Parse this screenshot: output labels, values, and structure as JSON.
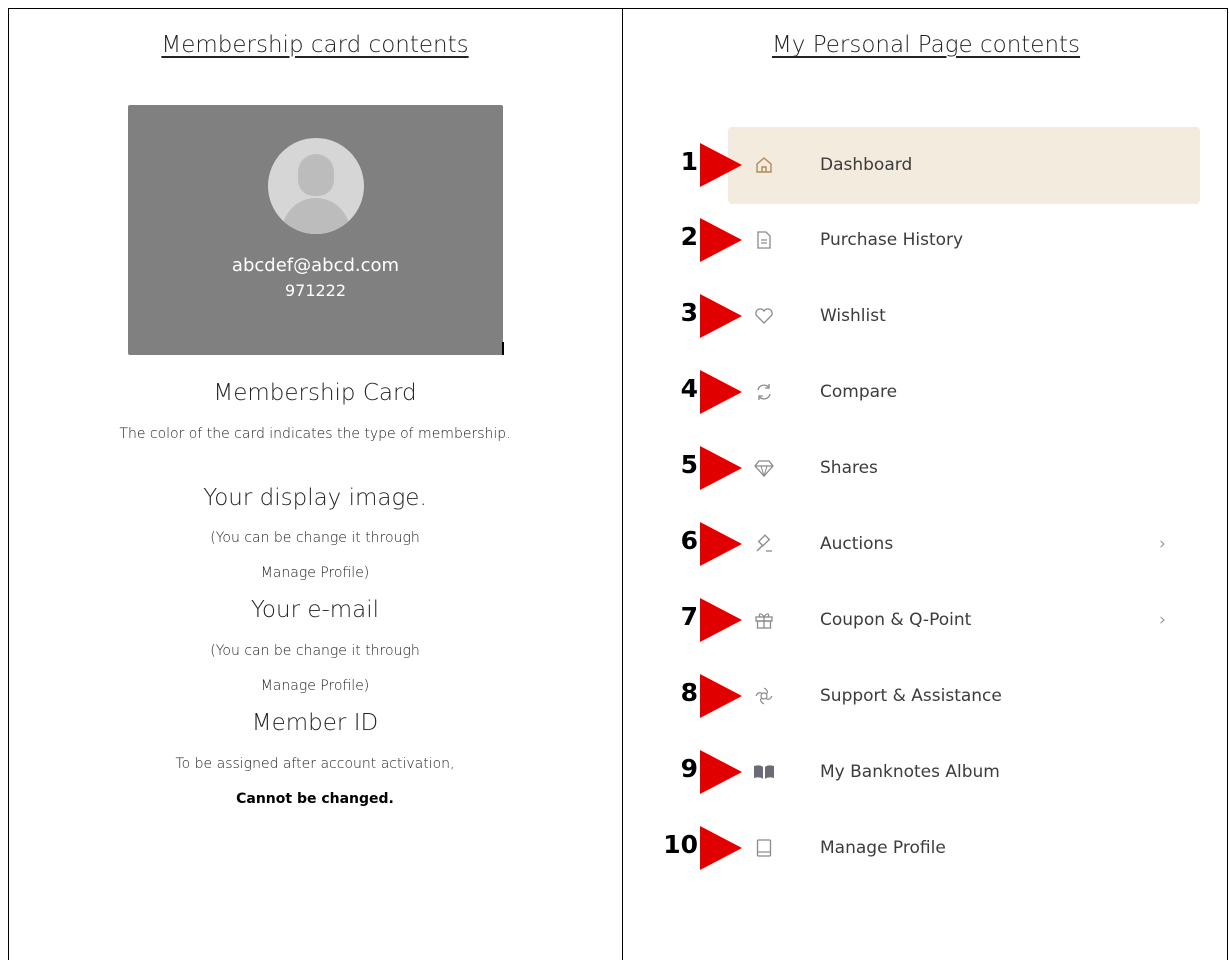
{
  "left": {
    "heading": "Membership card contents",
    "card": {
      "email": "abcdef@abcd.com",
      "member_id": "971222"
    },
    "card_title": "Membership Card",
    "card_desc": "The color of the card indicates the type of membership.",
    "display_image_title": "Your display image.",
    "display_image_note_1": "(You can be change it through",
    "display_image_note_2": "Manage Profile)",
    "email_title": "Your e-mail",
    "email_note_1": "(You can be change it through",
    "email_note_2": "Manage Profile)",
    "member_id_title": "Member ID",
    "member_id_note": "To be assigned after account activation,",
    "member_id_note_bold": "Cannot be changed."
  },
  "right": {
    "heading": "My Personal Page contents",
    "accent_color": "#e00000",
    "active_bg": "#f3ebde",
    "items": [
      {
        "number": "1",
        "icon": "home-icon",
        "label": "Dashboard",
        "active": true
      },
      {
        "number": "2",
        "icon": "document-icon",
        "label": "Purchase History"
      },
      {
        "number": "3",
        "icon": "heart-icon",
        "label": "Wishlist"
      },
      {
        "number": "4",
        "icon": "refresh-icon",
        "label": "Compare"
      },
      {
        "number": "5",
        "icon": "diamond-icon",
        "label": "Shares"
      },
      {
        "number": "6",
        "icon": "gavel-icon",
        "label": "Auctions",
        "chevron": "›"
      },
      {
        "number": "7",
        "icon": "gift-icon",
        "label": "Coupon & Q-Point",
        "chevron": "›"
      },
      {
        "number": "8",
        "icon": "support-icon",
        "label": "Support & Assistance"
      },
      {
        "number": "9",
        "icon": "book-icon",
        "label": "My Banknotes Album"
      },
      {
        "number": "10",
        "icon": "profile-icon",
        "label": "Manage Profile"
      }
    ]
  }
}
